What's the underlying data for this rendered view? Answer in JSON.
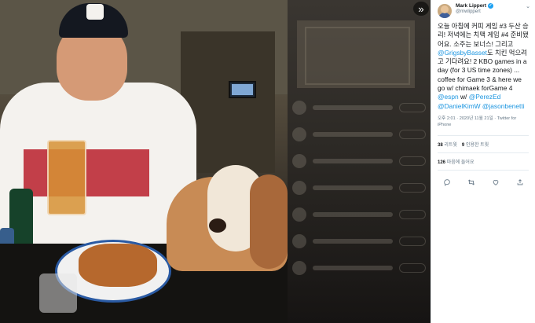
{
  "viewer": {
    "expand_icon": "double-chevron-right-icon"
  },
  "tweet": {
    "author_name": "Mark Lippert",
    "author_handle": "@mwlippert",
    "verified_icon": "verified-badge-icon",
    "text_segments": [
      {
        "type": "text",
        "value": "오늘 아침에 커피 게임 #3 두산 승리! 저녁에는 치맥 게임 #4 준비됐어요. 소주는 보너스! 그리고 "
      },
      {
        "type": "link",
        "value": "@GrigsbyBasset"
      },
      {
        "type": "text",
        "value": "도 치킨 먹으려고 기다려요! 2 KBO games in a day (for 3 US time zones) ... coffee for Game 3 & here we go w/ chimaek forGame 4 "
      },
      {
        "type": "link",
        "value": "@espn"
      },
      {
        "type": "text",
        "value": " w/ "
      },
      {
        "type": "link",
        "value": "@PerezEd"
      },
      {
        "type": "text",
        "value": " "
      },
      {
        "type": "link",
        "value": "@DanielKimW"
      },
      {
        "type": "text",
        "value": " "
      },
      {
        "type": "link",
        "value": "@jasonbenetti"
      }
    ],
    "timestamp": "오후 2:01 · 2020년 11월 21일 · Twitter for iPhone",
    "retweets_count": "38",
    "retweets_label": "리트윗",
    "quotes_count": "9",
    "quotes_label": "인용한 트윗",
    "likes_count": "126",
    "likes_label": "마음에 들어요"
  },
  "actions": {
    "reply_icon": "reply-icon",
    "retweet_icon": "retweet-icon",
    "like_icon": "heart-icon",
    "share_icon": "share-icon"
  },
  "colors": {
    "link": "#1b95e0",
    "verified": "#1da1f2",
    "text": "#14171a",
    "secondary": "#657786"
  }
}
